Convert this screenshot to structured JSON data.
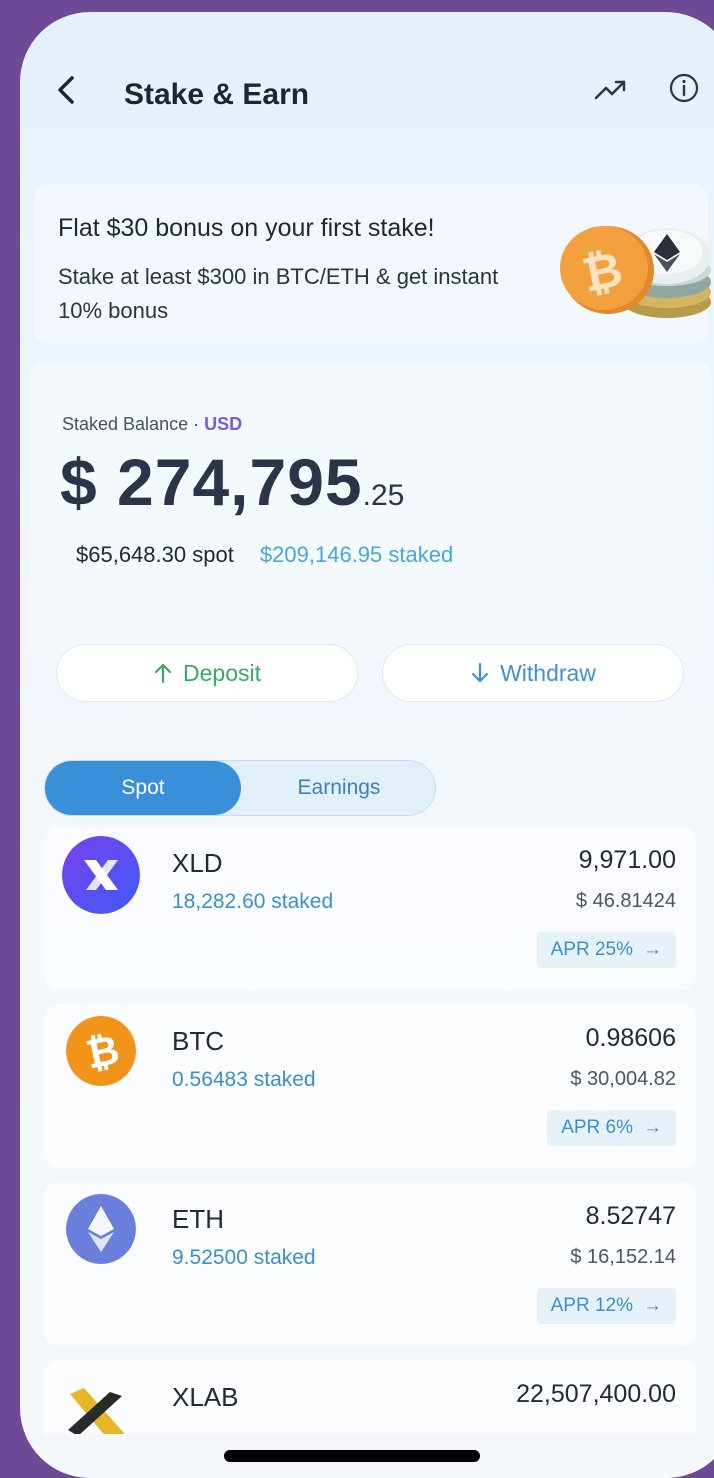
{
  "header": {
    "title": "Stake & Earn",
    "back_icon": "chevron-left-icon",
    "trend_icon": "trending-up-icon",
    "info_icon": "info-icon"
  },
  "promo": {
    "title": "Flat $30 bonus on your first stake!",
    "text": "Stake at least $300 in BTC/ETH & get instant 10% bonus"
  },
  "balance": {
    "label": "Staked Balance ·",
    "currency": "USD",
    "amount_main": "$ 274,795",
    "amount_cents": ".25",
    "spot": "$65,648.30 spot",
    "staked": "$209,146.95 staked"
  },
  "actions": {
    "deposit": "Deposit",
    "withdraw": "Withdraw"
  },
  "tabs": {
    "spot": "Spot",
    "earnings": "Earnings",
    "active": "spot"
  },
  "assets": [
    {
      "name": "XLD",
      "staked": "18,282.60 staked",
      "qty": "9,971.00",
      "value": "$ 46.81424",
      "apr": "APR 25%",
      "color": "#5b46f0"
    },
    {
      "name": "BTC",
      "staked": "0.56483 staked",
      "qty": "0.98606",
      "value": "$ 30,004.82",
      "apr": "APR 6%",
      "color": "#f2931a"
    },
    {
      "name": "ETH",
      "staked": "9.52500 staked",
      "qty": "8.52747",
      "value": "$ 16,152.14",
      "apr": "APR 12%",
      "color": "#6a7fdb"
    },
    {
      "name": "XLAB",
      "qty": "22,507,400.00",
      "color": "#e5b726"
    }
  ],
  "colors": {
    "accent": "#3a8fd9",
    "deposit": "#38a96a",
    "usd": "#7b5bd6"
  }
}
